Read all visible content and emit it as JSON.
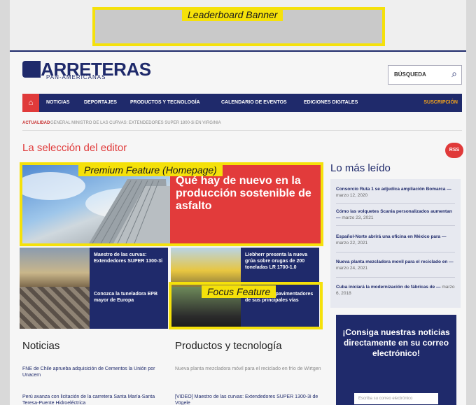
{
  "banner": {
    "label": "Leaderboard Banner"
  },
  "logo": {
    "name": "CARRETERAS",
    "sub": "PAN-AMERICANAS"
  },
  "search": {
    "label": "BÚSQUEDA"
  },
  "nav": {
    "items": [
      "NOTICIAS",
      "DEPORTAJES",
      "PRODUCTOS Y TECNOLOGÍA",
      "CALENDARIO DE EVENTOS",
      "EDICIONES DIGITALES"
    ],
    "subscribe": "SUSCRIPCIÓN"
  },
  "ticker": {
    "label": "ACTUALIDAD",
    "text": "GENERAL MINISTRO DE LAS CURVAS: EXTENDEDORES SUPER 1800-3i EN VIRGINIA"
  },
  "editor": {
    "title": "La selección del editor",
    "badge": "RSS"
  },
  "premium": {
    "tag": "Premium Feature (Homepage)",
    "headline": "Qué hay de nuevo en la producción sostenible de asfalto"
  },
  "cards": [
    {
      "text": "Maestro de las curvas: Extendedores SUPER 1300-3i"
    },
    {
      "text": "Liebherr presenta la nueva grúa sobre orugas de 200 toneladas LR 1700-1.0"
    },
    {
      "text": "Conozca la tuneladora EPB mayor de Europa"
    },
    {
      "text": "Presenta los pavimentadores de sus principales vías"
    }
  ],
  "focus": {
    "tag": "Focus Feature"
  },
  "noticias": {
    "title": "Noticias",
    "items": [
      "FNE de Chile aprueba adquisición de Cementos la Unión por Unacem",
      "Perú avanza con licitación de la carretera Santa María-Santa Teresa-Puente Hidroeléctrica"
    ]
  },
  "productos": {
    "title": "Productos y tecnología",
    "items": [
      "Nueva planta mezcladora móvil para el reciclado en frío de Wirtgen",
      "[VIDEO] Maestro de las curvas: Extendedores SUPER 1300-3i de Vögele"
    ]
  },
  "mas_leido": {
    "title": "Lo más leído",
    "items": [
      {
        "title": "Consorcio Ruta 1 se adjudica ampliación Bomarca",
        "meta": "marzo 12, 2020"
      },
      {
        "title": "Cómo las volquetes Scania personalizados aumentan",
        "meta": "marzo 23, 2021"
      },
      {
        "title": "Español-Norte abrirá una oficina en México para",
        "meta": "marzo 22, 2021"
      },
      {
        "title": "Nueva planta mezcladora movil para el reciclado en",
        "meta": "marzo 24, 2021"
      },
      {
        "title": "Cuba iniciará la modernización de fábricas de",
        "meta": "marzo 6, 2018"
      }
    ]
  },
  "newsletter": {
    "title": "¡Consiga nuestras noticias directamente en su correo electrónico!",
    "placeholder": "Escriba su correo electrónico"
  }
}
